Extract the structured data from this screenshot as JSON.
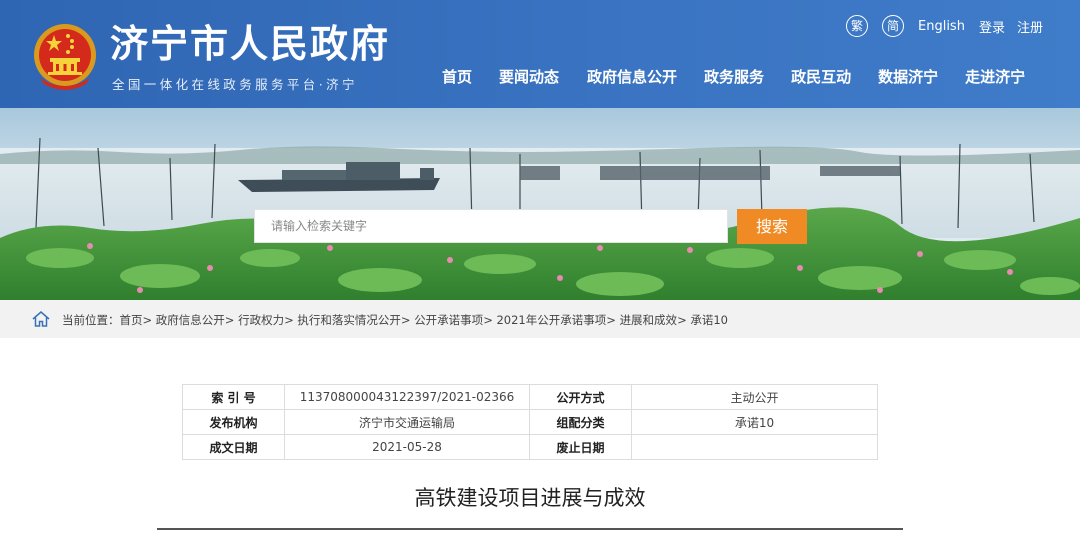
{
  "site": {
    "title": "济宁市人民政府",
    "subtitle": "全国一体化在线政务服务平台·济宁"
  },
  "top_links": {
    "traditional": "繁",
    "simplified": "简",
    "english": "English",
    "login": "登录",
    "register": "注册"
  },
  "nav": [
    "首页",
    "要闻动态",
    "政府信息公开",
    "政务服务",
    "政民互动",
    "数据济宁",
    "走进济宁"
  ],
  "search": {
    "placeholder": "请输入检索关键字",
    "button": "搜索"
  },
  "breadcrumb": {
    "prefix": "当前位置：",
    "items": [
      "首页",
      "政府信息公开",
      "行政权力",
      "执行和落实情况公开",
      "公开承诺事项",
      "2021年公开承诺事项",
      "进展和成效",
      "承诺10"
    ]
  },
  "meta": {
    "index_label": "索 引 号",
    "index_value": "113708000043122397/2021-02366",
    "mode_label": "公开方式",
    "mode_value": "主动公开",
    "org_label": "发布机构",
    "org_value": "济宁市交通运输局",
    "category_label": "组配分类",
    "category_value": "承诺10",
    "date_label": "成文日期",
    "date_value": "2021-05-28",
    "expire_label": "废止日期",
    "expire_value": ""
  },
  "document": {
    "title": "高铁建设项目进展与成效"
  },
  "colors": {
    "header_blue": "#3a74c2",
    "search_orange": "#f08a24"
  },
  "icons": [
    "national-emblem-icon",
    "home-icon"
  ]
}
